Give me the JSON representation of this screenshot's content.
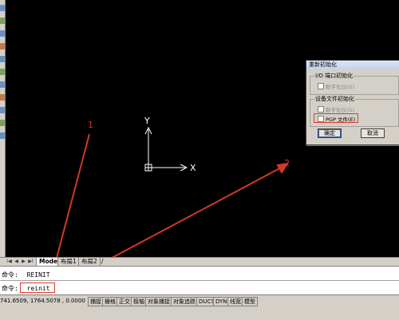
{
  "tabs": {
    "nav": [
      "I◀",
      "◀",
      "▶",
      "▶I"
    ],
    "model": "Model",
    "layout1": "布局1",
    "layout2": "布局2",
    "slash": "/"
  },
  "command": {
    "history_prompt": "命令:",
    "history_value": "REINIT",
    "input_prompt": "命令:",
    "input_value": "reinit"
  },
  "status": {
    "coords": "741.6509,  1764.5078 , 0.0000",
    "buttons": [
      "捕捉",
      "栅格",
      "正交",
      "极轴",
      "对象捕捉",
      "对象追踪",
      "DUCS",
      "DYN",
      "线宽",
      "模型"
    ]
  },
  "canvas": {
    "axis_y": "Y",
    "axis_x": "X"
  },
  "dialog": {
    "title": "重新初始化",
    "io_group": "I/O 端口初始化",
    "io_digitizer": "数字化仪(G)",
    "device_group": "设备文件初始化",
    "device_digitizer": "数字化仪(G)",
    "pgp_file": "PGP 文件(E)",
    "ok": "确定",
    "cancel": "取消"
  },
  "annotations": {
    "step1": "1",
    "step2": "2"
  },
  "colors": {
    "annotation": "#d0392a",
    "canvas_bg": "#000000",
    "chrome": "#d4d0c8"
  }
}
